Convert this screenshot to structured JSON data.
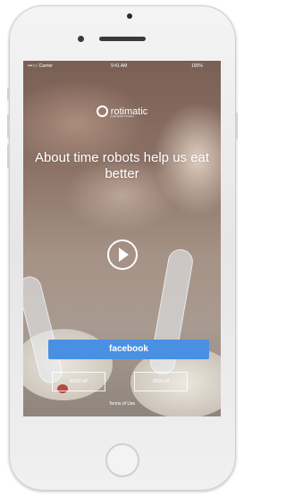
{
  "status_bar": {
    "carrier": "•••○○ Carrier",
    "time": "9:41 AM",
    "battery": "100%"
  },
  "brand": {
    "name": "rotimatic",
    "tagline": "A Zimplistic Product"
  },
  "hero": {
    "headline": "About time robots help us eat better"
  },
  "buttons": {
    "facebook": "facebook",
    "left": "SIGN UP",
    "right": "SIGN IN"
  },
  "footer": {
    "terms": "Terms of Use"
  },
  "colors": {
    "facebook": "#4a90e2",
    "text": "#ffffff"
  }
}
